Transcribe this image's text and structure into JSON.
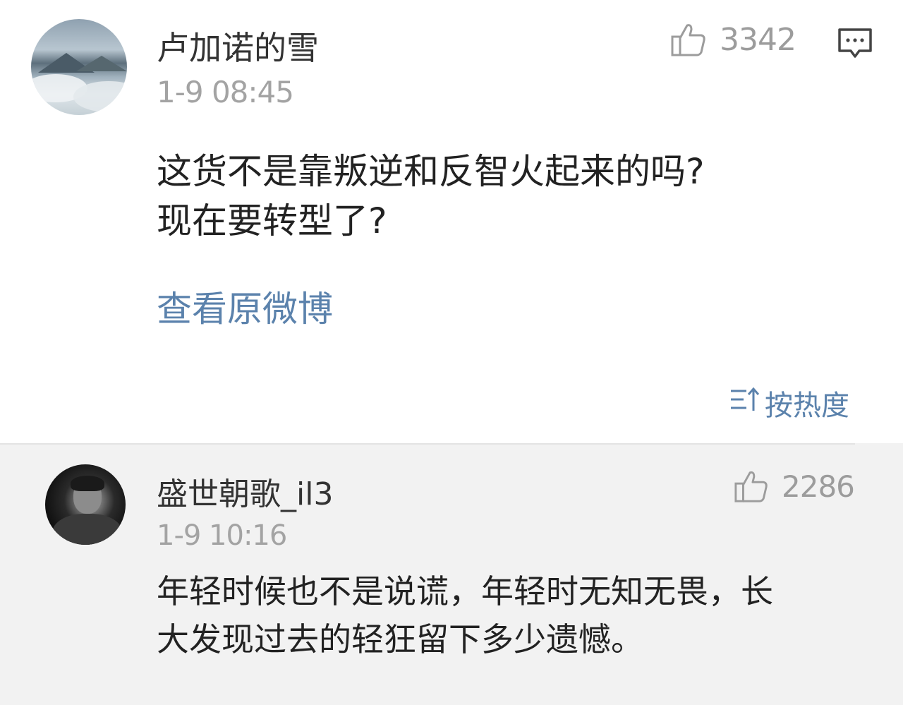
{
  "main_post": {
    "username": "卢加诺的雪",
    "timestamp": "1-9  08:45",
    "like_count": "3342",
    "text_lines": [
      "这货不是靠叛逆和反智火起来的吗?",
      "现在要转型了?"
    ],
    "view_original_label": "查看原微博"
  },
  "sort": {
    "label": "按热度"
  },
  "reply": {
    "username": "盛世朝歌_il3",
    "timestamp": "1-9  10:16",
    "like_count": "2286",
    "text_lines": [
      "年轻时候也不是说谎，年轻时无知无畏，长",
      "大发现过去的轻狂留下多少遗憾。"
    ]
  },
  "colors": {
    "link": "#5b82ac",
    "muted": "#a3a3a3",
    "reply_background": "#f2f2f2"
  },
  "icons": {
    "like": "thumbs-up-icon",
    "comment": "comment-bubble-icon",
    "sort": "sort-icon"
  }
}
